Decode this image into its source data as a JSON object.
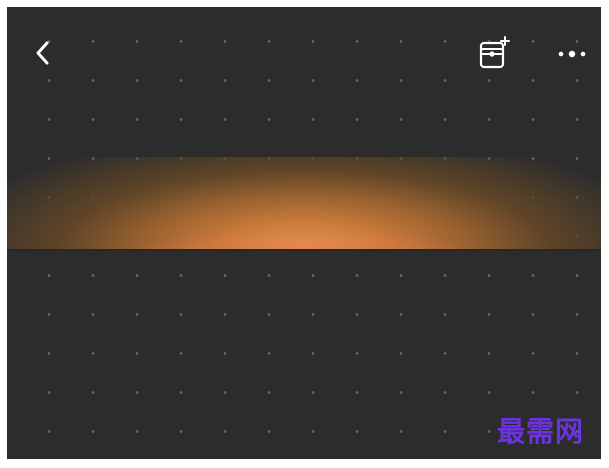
{
  "header": {
    "back_icon": "chevron-left-icon",
    "album_icon": "photo-album-add-icon",
    "more_icon": "more-dots-icon"
  },
  "colors": {
    "background": "#2c2c2c",
    "glow_center": "#e59a52",
    "glow_red": "#e67850",
    "dots": "#6a6a6a",
    "icons": "#ffffff"
  },
  "watermark": {
    "text": "最需网",
    "color": "#6b32e0"
  }
}
